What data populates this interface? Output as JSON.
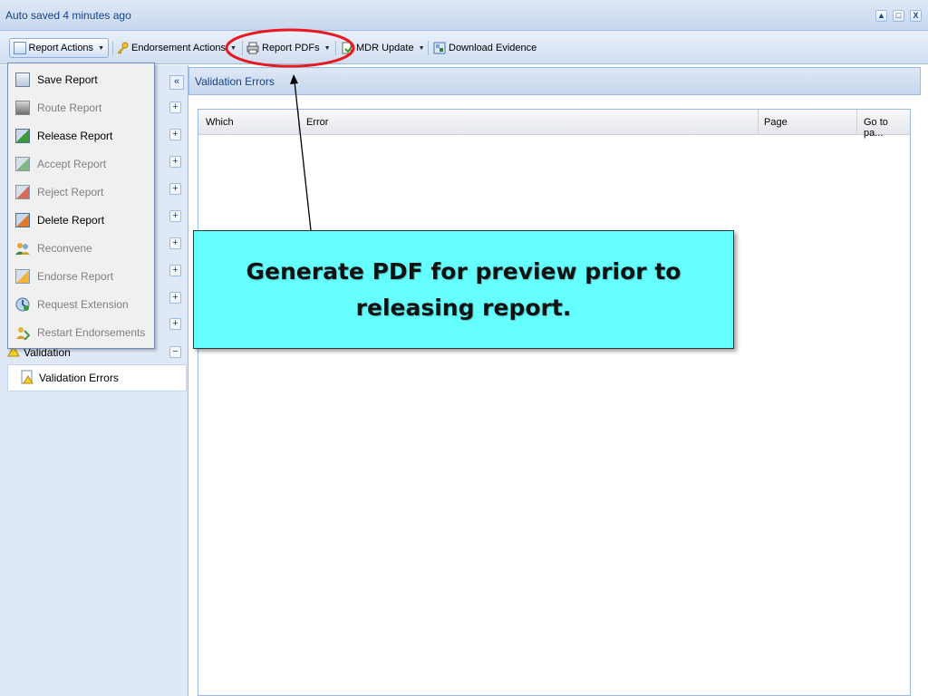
{
  "window": {
    "title": "Auto saved 4 minutes ago",
    "controls": [
      "▲",
      "□",
      "X"
    ]
  },
  "toolbar": {
    "report_actions": "Report Actions",
    "endorsement_actions": "Endorsement Actions",
    "report_pdfs": "Report PDFs",
    "mdr_update": "MDR Update",
    "download_evidence": "Download Evidence",
    "dropdown_arrow": "▼"
  },
  "menu": {
    "items": [
      {
        "label": "Save Report",
        "icon": "save-report-icon",
        "enabled": true
      },
      {
        "label": "Route Report",
        "icon": "route-report-icon",
        "enabled": false
      },
      {
        "label": "Release Report",
        "icon": "release-report-icon",
        "enabled": true
      },
      {
        "label": "Accept Report",
        "icon": "accept-report-icon",
        "enabled": false
      },
      {
        "label": "Reject Report",
        "icon": "reject-report-icon",
        "enabled": false
      },
      {
        "label": "Delete Report",
        "icon": "delete-report-icon",
        "enabled": true
      },
      {
        "label": "Reconvene",
        "icon": "reconvene-icon",
        "enabled": false
      },
      {
        "label": "Endorse Report",
        "icon": "endorse-report-icon",
        "enabled": false
      },
      {
        "label": "Request Extension",
        "icon": "request-extension-icon",
        "enabled": false
      },
      {
        "label": "Restart Endorsements",
        "icon": "restart-endorsements-icon",
        "enabled": false
      }
    ]
  },
  "left_panel": {
    "collapse_glyph": "«",
    "expand_glyph": "+",
    "collapse_section_glyph": "−",
    "validation_section": "Validation",
    "validation_errors_item": "Validation Errors"
  },
  "main": {
    "panel_title": "Validation Errors",
    "columns": [
      "Which",
      "Error",
      "Page",
      "Go to pa..."
    ]
  },
  "annotation": {
    "text": "Generate PDF for preview prior to releasing report.",
    "background": "#66ffff",
    "highlight_color": "#e8191f"
  }
}
